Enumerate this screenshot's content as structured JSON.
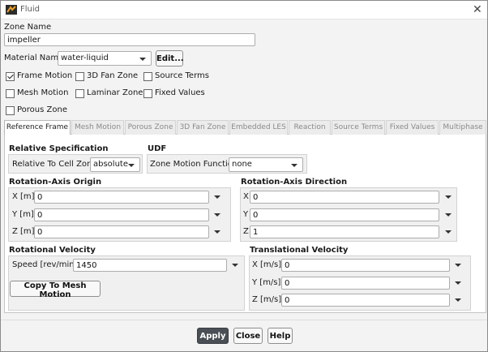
{
  "window": {
    "title": "Fluid",
    "close_glyph": "✕"
  },
  "zone": {
    "label": "Zone Name",
    "value": "impeller"
  },
  "material": {
    "label": "Material Name",
    "value": "water-liquid",
    "edit_label": "Edit..."
  },
  "options": {
    "frame_motion": {
      "label": "Frame Motion",
      "checked": true
    },
    "fan_zone": {
      "label": "3D Fan Zone",
      "checked": false
    },
    "source_terms": {
      "label": "Source Terms",
      "checked": false
    },
    "mesh_motion": {
      "label": "Mesh Motion",
      "checked": false
    },
    "laminar_zone": {
      "label": "Laminar Zone",
      "checked": false
    },
    "fixed_values": {
      "label": "Fixed Values",
      "checked": false
    },
    "porous_zone": {
      "label": "Porous Zone",
      "checked": false
    }
  },
  "tabs": [
    "Reference Frame",
    "Mesh Motion",
    "Porous Zone",
    "3D Fan Zone",
    "Embedded LES",
    "Reaction",
    "Source Terms",
    "Fixed Values",
    "Multiphase"
  ],
  "active_tab": "Reference Frame",
  "relative_spec": {
    "title": "Relative Specification",
    "label": "Relative To Cell Zone",
    "value": "absolute"
  },
  "udf": {
    "title": "UDF",
    "label": "Zone Motion Function",
    "value": "none"
  },
  "rotation_origin": {
    "title": "Rotation-Axis Origin",
    "rows": [
      {
        "label": "X [m]",
        "value": "0"
      },
      {
        "label": "Y [m]",
        "value": "0"
      },
      {
        "label": "Z [m]",
        "value": "0"
      }
    ]
  },
  "rotation_direction": {
    "title": "Rotation-Axis Direction",
    "rows": [
      {
        "label": "X",
        "value": "0"
      },
      {
        "label": "Y",
        "value": "0"
      },
      {
        "label": "Z",
        "value": "1"
      }
    ]
  },
  "rotational_velocity": {
    "title": "Rotational Velocity",
    "label": "Speed [rev/min]",
    "value": "1450",
    "copy_label": "Copy To Mesh Motion"
  },
  "translational_velocity": {
    "title": "Translational Velocity",
    "rows": [
      {
        "label": "X [m/s]",
        "value": "0"
      },
      {
        "label": "Y [m/s]",
        "value": "0"
      },
      {
        "label": "Z [m/s]",
        "value": "0"
      }
    ]
  },
  "footer": {
    "apply": "Apply",
    "close": "Close",
    "help": "Help"
  }
}
